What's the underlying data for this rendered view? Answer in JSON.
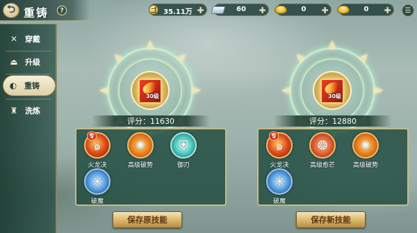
{
  "header": {
    "back_glyph": "⮌",
    "title": "重铸",
    "help_glyph": "?"
  },
  "resources": [
    {
      "icon": "coin-icon",
      "icon_glyph": "ゴ",
      "value": "35.11万"
    },
    {
      "icon": "silver-bar-icon",
      "value": "60"
    },
    {
      "icon": "gold-ingot-icon",
      "value": "0"
    },
    {
      "icon": "gold-ingot-icon",
      "value": "0"
    }
  ],
  "resource_plus": "✚",
  "menu_glyph": "☰",
  "sidebar": {
    "items": [
      {
        "label": "穿戴",
        "icon": "crossed-swords-icon",
        "glyph": "✕",
        "active": false
      },
      {
        "label": "升级",
        "icon": "level-up-icon",
        "glyph": "⏏",
        "active": false
      },
      {
        "label": "重铸",
        "icon": "recast-icon",
        "glyph": "◐",
        "active": true
      },
      {
        "label": "洗炼",
        "icon": "refine-icon",
        "glyph": "♜",
        "active": false
      }
    ]
  },
  "left_panel": {
    "book_level": "30级",
    "score_label": "评分：11630",
    "skills": [
      {
        "name": "火龙决",
        "type": "fire",
        "tag": "专",
        "glyph": "๑"
      },
      {
        "name": "高级破势",
        "type": "sun",
        "glyph": "✺"
      },
      {
        "name": "御刃",
        "type": "ice",
        "glyph": "⛨"
      },
      {
        "name": "破魔",
        "type": "frost",
        "glyph": "✳"
      }
    ],
    "button": "保存原技能"
  },
  "right_panel": {
    "book_level": "30级",
    "score_label": "评分：12880",
    "skills": [
      {
        "name": "火龙决",
        "type": "fire",
        "tag": "专",
        "glyph": "๑"
      },
      {
        "name": "高级愈芒",
        "type": "crimson",
        "glyph": "❂"
      },
      {
        "name": "高级破势",
        "type": "sun",
        "glyph": "✺"
      },
      {
        "name": "破魔",
        "type": "frost",
        "glyph": "✳"
      }
    ],
    "button": "保存新技能"
  }
}
